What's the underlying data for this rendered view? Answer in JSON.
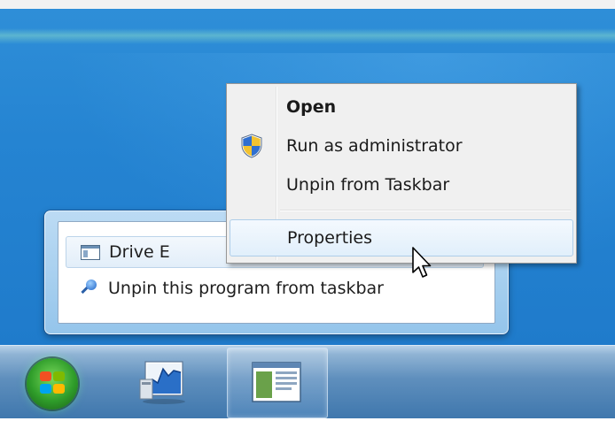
{
  "context_menu": {
    "items": [
      {
        "label": "Open"
      },
      {
        "label": "Run as administrator",
        "icon": "uac-shield-icon"
      },
      {
        "label": "Unpin from Taskbar"
      },
      {
        "label": "Properties"
      }
    ]
  },
  "jump_list": {
    "items": [
      {
        "label": "Drive E",
        "icon": "window-icon"
      },
      {
        "label": "Unpin this program from taskbar",
        "icon": "pin-icon"
      }
    ]
  },
  "taskbar": {
    "items": [
      "start-button",
      "performance-monitor-app",
      "explorer-window-app"
    ]
  },
  "colors": {
    "desktop": "#2584d2",
    "menu_background": "#f0f0f0",
    "highlight": "#e1effb"
  }
}
